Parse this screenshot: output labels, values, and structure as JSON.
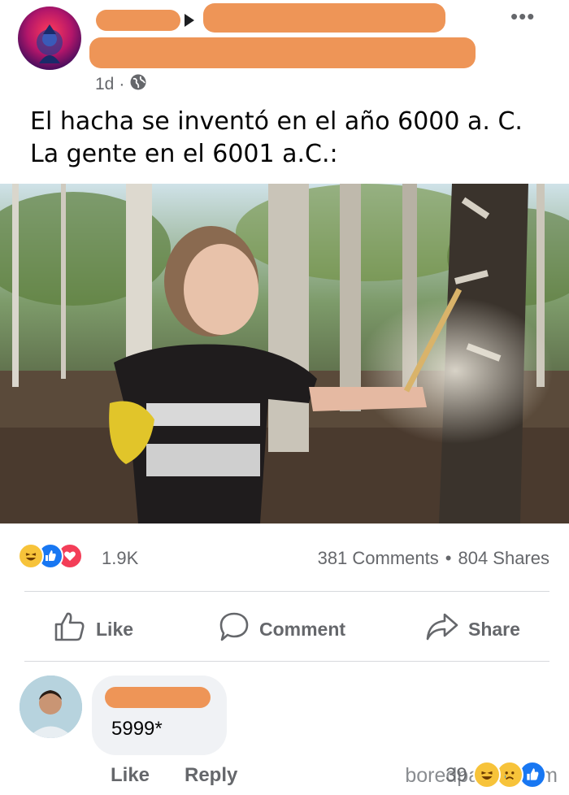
{
  "post": {
    "time": "1d",
    "separator": "·",
    "more": "•••",
    "text_line1": "El hacha se inventó en el año 6000 a. C.",
    "text_line2": "La gente en el 6001 a.C.:"
  },
  "stats": {
    "reaction_count": "1.9K",
    "comments": "381 Comments",
    "dot": "•",
    "shares": "804 Shares"
  },
  "actions": {
    "like": "Like",
    "comment": "Comment",
    "share": "Share"
  },
  "comment": {
    "text": "5999*",
    "like": "Like",
    "reply": "Reply",
    "reaction_count": "39"
  },
  "watermark": "boredpanda.com",
  "colors": {
    "muted": "#65676b",
    "bubble": "#f0f2f5",
    "redaction": "#ee9557",
    "like_blue": "#1877f2",
    "love_red": "#f33e58",
    "haha_yellow": "#f7c33a"
  }
}
